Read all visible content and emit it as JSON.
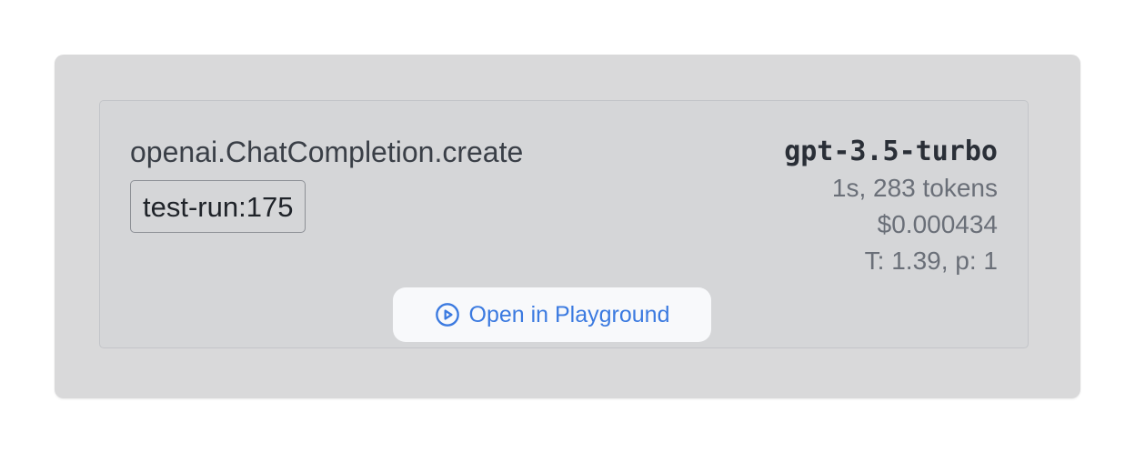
{
  "card": {
    "function_name": "openai.ChatCompletion.create",
    "tag": "test-run:175",
    "model": "gpt-3.5-turbo",
    "duration_tokens": "1s, 283 tokens",
    "cost": "$0.000434",
    "params": "T: 1.39, p: 1",
    "playground_button": {
      "label": "Open in Playground",
      "icon": "play-circle-icon"
    }
  },
  "colors": {
    "accent": "#3b7ae0",
    "outer_background": "#d9d9da",
    "button_background": "#f8f9fb"
  }
}
